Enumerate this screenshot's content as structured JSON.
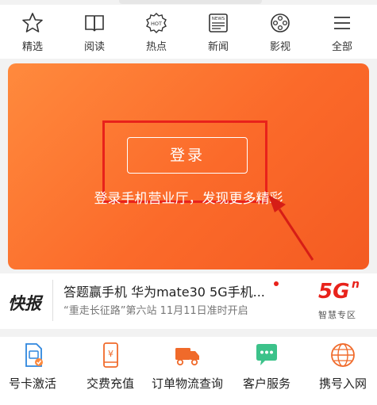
{
  "top_nav": [
    {
      "label": "精选",
      "icon": "star-icon"
    },
    {
      "label": "阅读",
      "icon": "book-icon"
    },
    {
      "label": "热点",
      "icon": "hot-icon",
      "icon_text": "HOT"
    },
    {
      "label": "新闻",
      "icon": "news-icon",
      "icon_text": "NEWS"
    },
    {
      "label": "影视",
      "icon": "film-reel-icon"
    },
    {
      "label": "全部",
      "icon": "menu-icon"
    }
  ],
  "banner": {
    "login_label": "登录",
    "hint": "登录手机营业厅，发现更多精彩",
    "accent": "#fb6a2a"
  },
  "news": {
    "tag": "快报",
    "title": "答题赢手机 华为mate30 5G手机...",
    "subtitle": "“重走长征路”第六站 11月11日准时开启",
    "badge_big": "5G",
    "badge_sup": "n",
    "badge_zone": "智慧专区"
  },
  "services": [
    {
      "label": "号卡激活",
      "icon": "sim-card-icon"
    },
    {
      "label": "交费充值",
      "icon": "phone-yuan-icon"
    },
    {
      "label": "订单物流查询",
      "icon": "delivery-truck-icon"
    },
    {
      "label": "客户服务",
      "icon": "chat-bubble-icon"
    },
    {
      "label": "携号入网",
      "icon": "globe-icon"
    }
  ]
}
